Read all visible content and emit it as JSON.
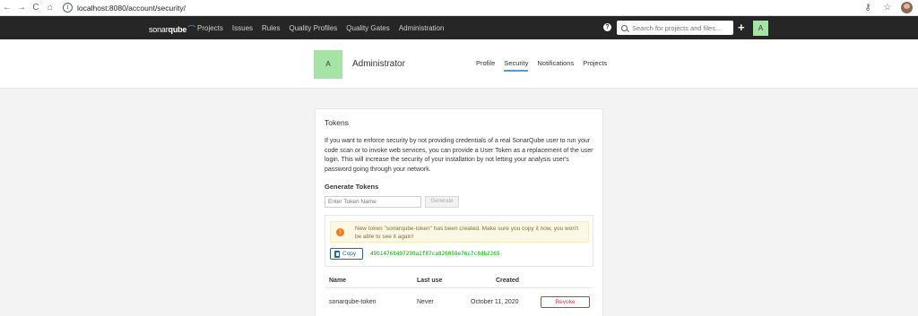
{
  "browser": {
    "back_icon": "←",
    "forward_icon": "→",
    "reload_icon": "C",
    "home_icon": "⌂",
    "info_icon": "i",
    "url": "localhost:8080/account/security/",
    "key_icon": "⚷",
    "star_icon": "☆"
  },
  "nav": {
    "logo_text_1": "sonar",
    "logo_text_2": "qube",
    "items": [
      "Projects",
      "Issues",
      "Rules",
      "Quality Profiles",
      "Quality Gates",
      "Administration"
    ],
    "help_label": "?",
    "search_placeholder": "Search for projects and files...",
    "plus_label": "+",
    "avatar_letter": "A"
  },
  "account": {
    "avatar_letter": "A",
    "name": "Administrator",
    "tabs": [
      "Profile",
      "Security",
      "Notifications",
      "Projects"
    ],
    "active_tab": "Security"
  },
  "tokens": {
    "title": "Tokens",
    "description": "If you want to enforce security by not providing credentials of a real SonarQube user to run your code scan or to invoke web services, you can provide a User Token as a replacement of the user login. This will increase the security of your installation by not letting your analysis user's password going through your network.",
    "generate_title": "Generate Tokens",
    "input_placeholder": "Enter Token Name",
    "generate_label": "Generate",
    "alert_icon": "!",
    "alert_text": "New token \"sonarqube-token\" has been created. Make sure you copy it now, you won't be able to see it again!",
    "copy_label": "Copy",
    "token_value": "49b14768497290a1f87ca826058e76c7c8db2265",
    "table": {
      "headers": [
        "Name",
        "Last use",
        "Created"
      ],
      "rows": [
        {
          "name": "sonarqube-token",
          "last_use": "Never",
          "created": "October 11, 2020",
          "action": "Revoke"
        }
      ]
    }
  },
  "colors": {
    "nav_bg": "#262626",
    "avatar_bg": "#a6e4a6",
    "accent_blue": "#4b9fd5",
    "token_green": "#00aa00",
    "revoke_red": "#d4333f",
    "alert_bg": "#fcf8e3"
  }
}
